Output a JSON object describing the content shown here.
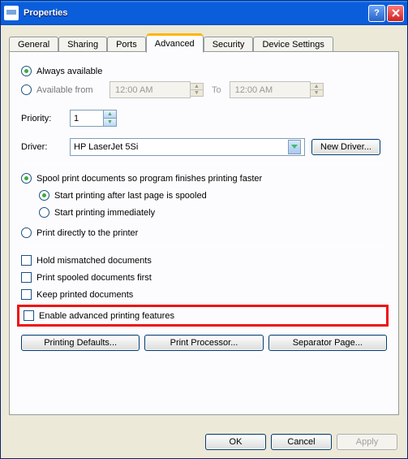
{
  "titlebar": {
    "title": "Properties"
  },
  "tabs": {
    "general": "General",
    "sharing": "Sharing",
    "ports": "Ports",
    "advanced": "Advanced",
    "security": "Security",
    "device_settings": "Device Settings"
  },
  "availability": {
    "always": "Always available",
    "from": "Available from",
    "time_from": "12:00 AM",
    "to_label": "To",
    "time_to": "12:00 AM"
  },
  "priority": {
    "label": "Priority:",
    "value": "1"
  },
  "driver": {
    "label": "Driver:",
    "value": "HP LaserJet 5Si",
    "new_driver_btn": "New Driver..."
  },
  "spool": {
    "spool_label": "Spool print documents so program finishes printing faster",
    "start_after_last": "Start printing after last page is spooled",
    "start_immediately": "Start printing immediately",
    "print_direct": "Print directly to the printer"
  },
  "options": {
    "hold_mismatched": "Hold mismatched documents",
    "print_spooled_first": "Print spooled documents first",
    "keep_printed": "Keep printed documents",
    "enable_advanced": "Enable advanced printing features"
  },
  "bottom_buttons": {
    "printing_defaults": "Printing Defaults...",
    "print_processor": "Print Processor...",
    "separator_page": "Separator Page..."
  },
  "dialog_buttons": {
    "ok": "OK",
    "cancel": "Cancel",
    "apply": "Apply"
  }
}
